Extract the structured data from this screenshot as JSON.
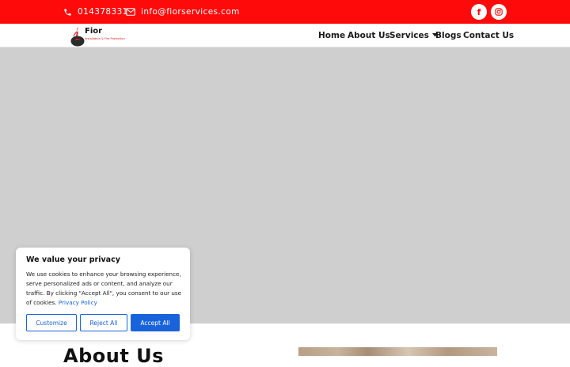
{
  "topbar": {
    "phone": "014378331",
    "email": "info@fiorservices.com",
    "phone_icon": "phone-icon",
    "email_icon": "envelope-icon",
    "social": [
      {
        "icon": "facebook-icon",
        "glyph": "f"
      },
      {
        "icon": "instagram-icon"
      }
    ]
  },
  "header": {
    "logo_name": "Fior",
    "logo_tagline": "Installation & Fire Protection",
    "nav": [
      "Home",
      "About Us",
      "Services",
      "Blogs",
      "Contact Us"
    ]
  },
  "about": {
    "title": "About Us"
  },
  "cookie": {
    "title": "We value your privacy",
    "body": "We use cookies to enhance your browsing experience, serve personalized ads or content, and analyze our traffic. By clicking \"Accept All\", you consent to our use of cookies.",
    "policy_link": "Privacy Policy",
    "customize": "Customize",
    "reject": "Reject All",
    "accept": "Accept All"
  },
  "colors": {
    "topbar": "#ff0a0a",
    "hero_placeholder": "#cfcfcf",
    "cookie_accent": "#1863dc"
  }
}
